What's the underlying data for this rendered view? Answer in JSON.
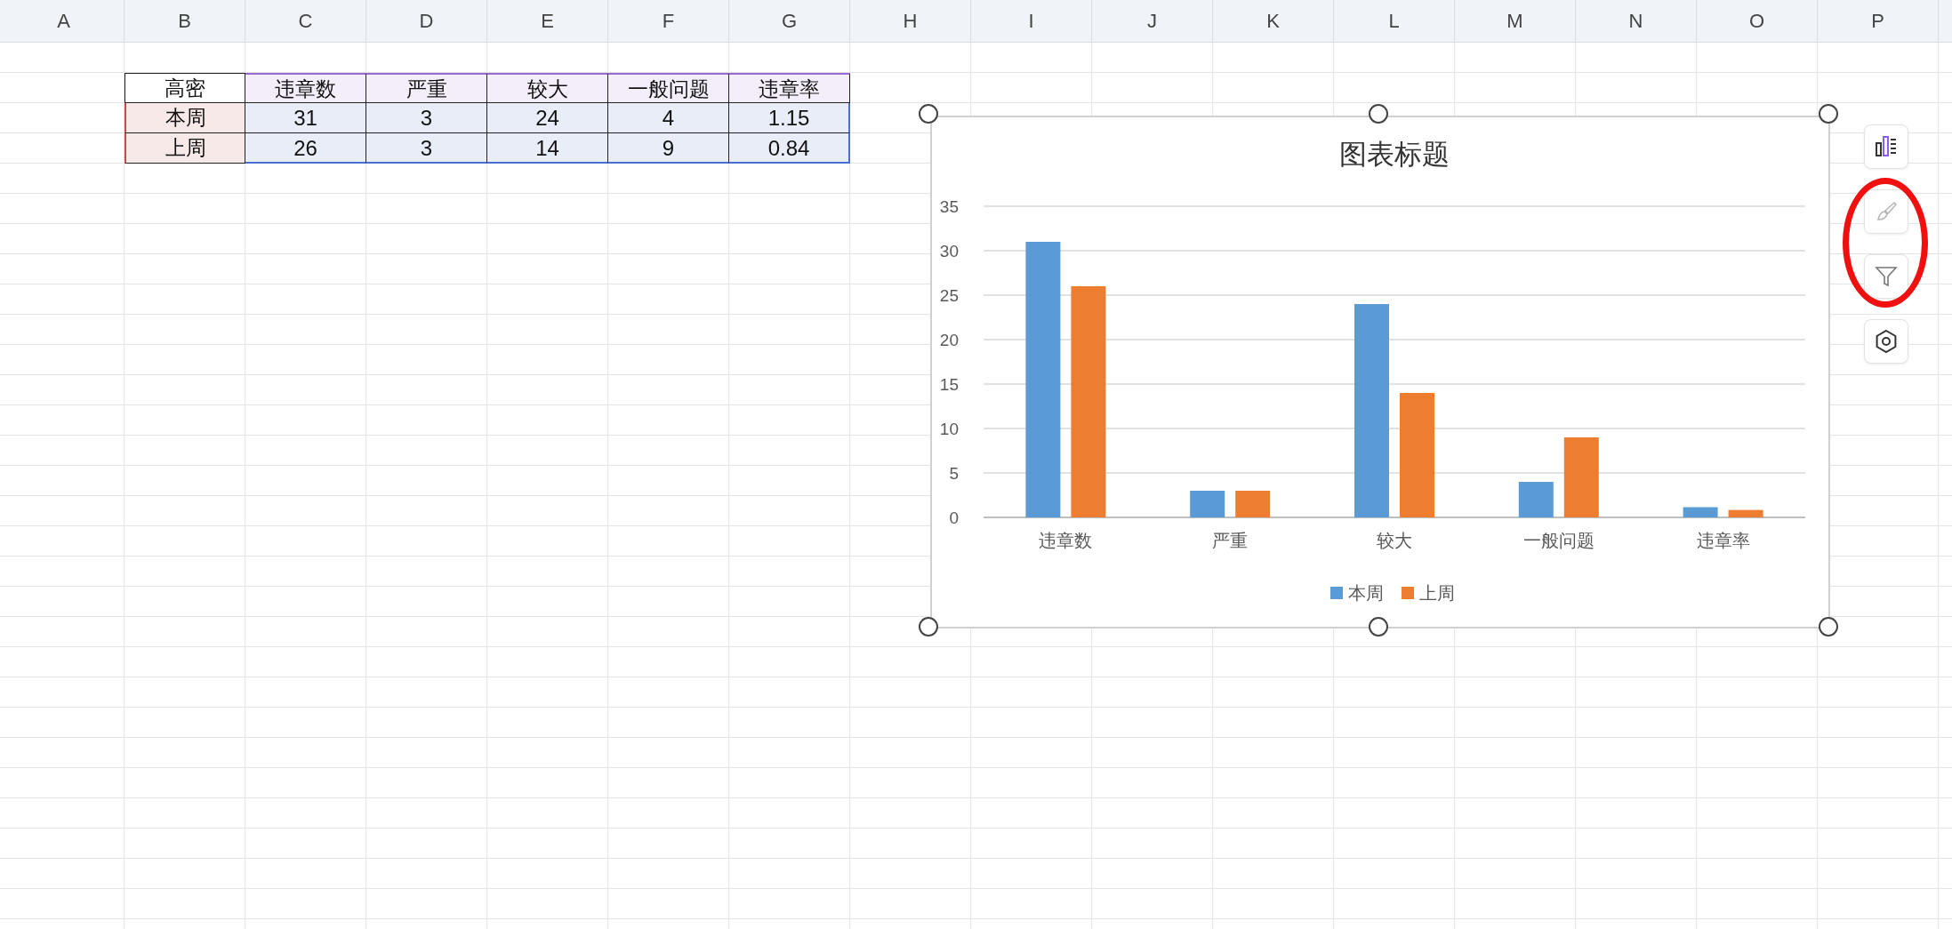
{
  "column_headers": [
    "A",
    "B",
    "C",
    "D",
    "E",
    "F",
    "G",
    "H",
    "I",
    "J",
    "K",
    "L",
    "M",
    "N",
    "O",
    "P"
  ],
  "table": {
    "columns": [
      "高密",
      "违章数",
      "严重",
      "较大",
      "一般问题",
      "违章率"
    ],
    "rows": [
      [
        "本周",
        "31",
        "3",
        "24",
        "4",
        "1.15"
      ],
      [
        "上周",
        "26",
        "3",
        "14",
        "9",
        "0.84"
      ]
    ]
  },
  "chart": {
    "chart_data": {
      "type": "bar",
      "grid": true,
      "legend": true,
      "title": "图表标题",
      "categories": [
        "违章数",
        "严重",
        "较大",
        "一般问题",
        "违章率"
      ],
      "ylim": [
        0,
        35
      ],
      "yticks": [
        0,
        5,
        10,
        15,
        20,
        25,
        30,
        35
      ],
      "series": [
        {
          "name": "本周",
          "color": "#5b9bd5",
          "values": [
            31,
            3,
            24,
            4,
            1.15
          ]
        },
        {
          "name": "上周",
          "color": "#ed7d31",
          "values": [
            26,
            3,
            14,
            9,
            0.84
          ]
        }
      ]
    }
  }
}
